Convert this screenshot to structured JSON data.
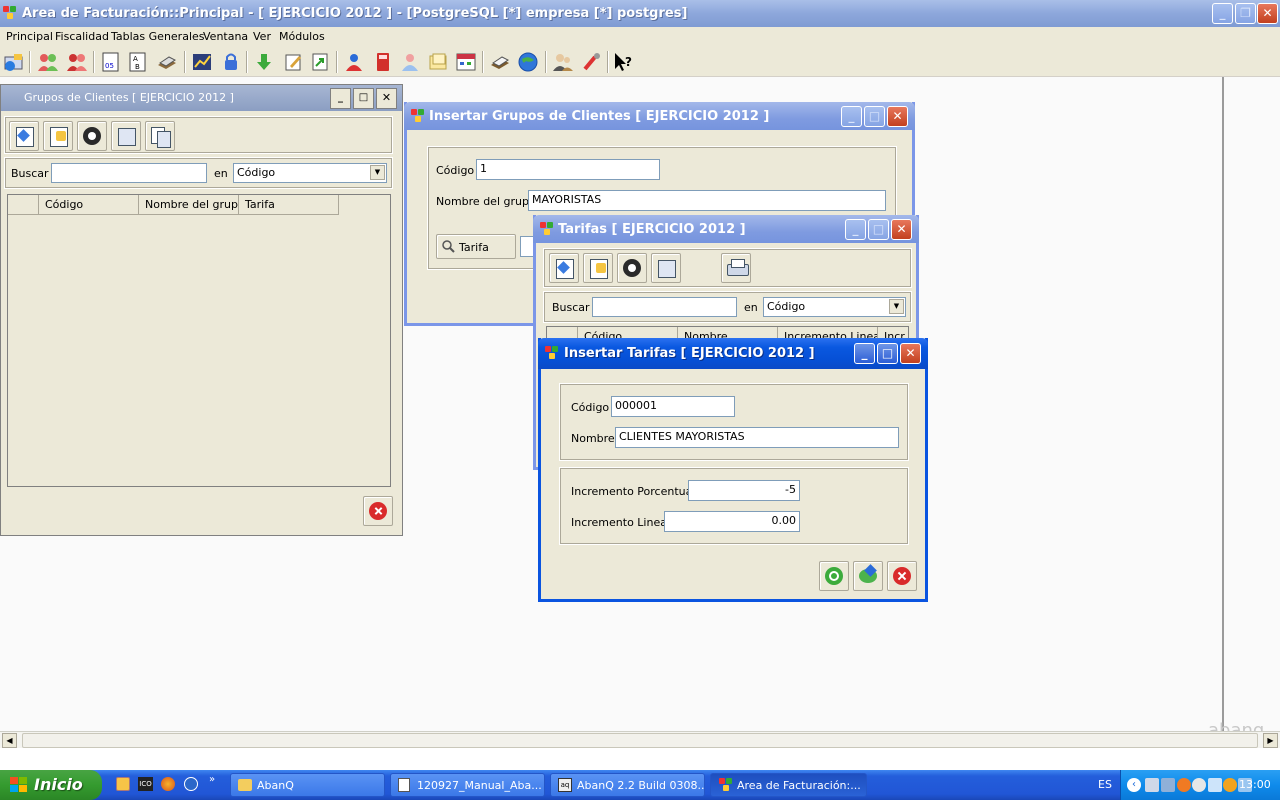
{
  "app": {
    "title": "Area de Facturación::Principal  - [ EJERCICIO 2012 ] - [PostgreSQL [*] empresa [*] postgres]",
    "watermark": "abanq"
  },
  "menu": [
    "Principal",
    "Fiscalidad",
    "Tablas Generales",
    "Ventana",
    "Ver",
    "Módulos"
  ],
  "grupos_window": {
    "title": "Grupos de Clientes [ EJERCICIO 2012 ]",
    "search_label": "Buscar",
    "search_value": "",
    "in_label": "en",
    "search_field": "Código",
    "columns": [
      "Código",
      "Nombre del grupo",
      "Tarifa"
    ]
  },
  "insert_grupo": {
    "title": "Insertar Grupos de Clientes [ EJERCICIO 2012 ]",
    "codigo_label": "Código",
    "codigo_value": "1",
    "nombre_label": "Nombre del grupo",
    "nombre_value": "MAYORISTAS",
    "tarifa_button": "Tarifa"
  },
  "tarifas_window": {
    "title": "Tarifas [ EJERCICIO 2012 ]",
    "search_label": "Buscar",
    "search_value": "",
    "in_label": "en",
    "search_field": "Código",
    "columns": [
      "Código",
      "Nombre",
      "Incremento Lineal",
      "Incr"
    ]
  },
  "insert_tarifa": {
    "title": "Insertar Tarifas [ EJERCICIO 2012 ]",
    "codigo_label": "Código",
    "codigo_value": "000001",
    "nombre_label": "Nombre",
    "nombre_value": "CLIENTES MAYORISTAS",
    "inc_porc_label": "Incremento Porcentual",
    "inc_porc_value": "-5",
    "inc_lineal_label": "Incremento Lineal",
    "inc_lineal_value": "0.00"
  },
  "taskbar": {
    "start_label": "Inicio",
    "tasks": [
      "AbanQ",
      "120927_Manual_Aba...",
      "AbanQ 2.2 Build 0308...",
      "Area de Facturación:..."
    ],
    "lang": "ES",
    "clock": "13:00"
  },
  "colors": {
    "titlebar": "#8da7db",
    "window_bg": "#ece9d8",
    "xp_blue": "#0a54e0",
    "taskbar": "#245edb",
    "start_green": "#359b2f"
  }
}
